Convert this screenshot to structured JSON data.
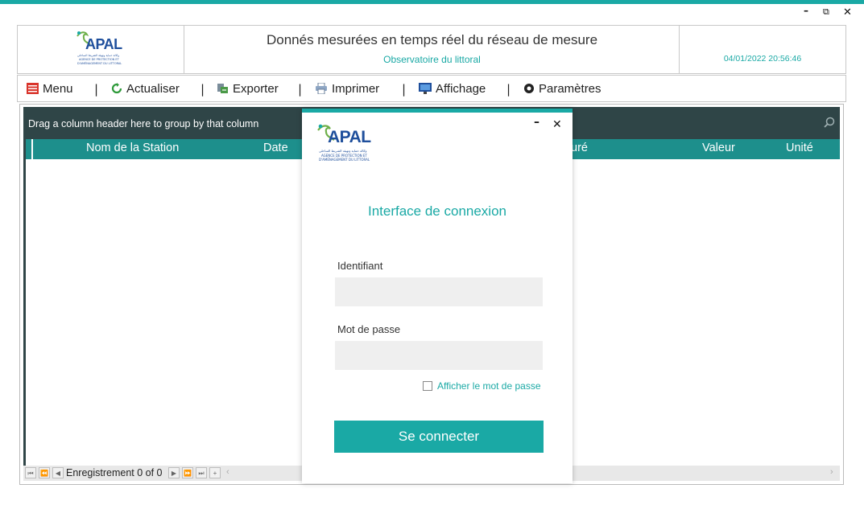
{
  "window": {
    "minimize": "–",
    "restore": "⧉",
    "close": "✕"
  },
  "header": {
    "title": "Donnés mesurées en temps réel du réseau de mesure",
    "subtitle": "Observatoire du littoral",
    "datetime": "04/01/2022 20:56:46",
    "logo": {
      "brand": "APAL",
      "line1": "وكالة حماية وتهيئة الشريط الساحلي",
      "line2": "AGENCE DE PROTECTION ET",
      "line3": "D'AMÉNAGEMENT DU LITTORAL"
    }
  },
  "toolbar": {
    "items": [
      {
        "label": "Menu",
        "icon": "menu-icon"
      },
      {
        "label": "Actualiser",
        "icon": "refresh-icon"
      },
      {
        "label": "Exporter",
        "icon": "export-icon"
      },
      {
        "label": "Imprimer",
        "icon": "printer-icon"
      },
      {
        "label": "Affichage",
        "icon": "monitor-icon"
      },
      {
        "label": "Paramètres",
        "icon": "gear-icon"
      }
    ],
    "separator": "|"
  },
  "grid": {
    "group_hint": "Drag a column header here to group by that column",
    "columns": [
      "Nom de la Station",
      "Date",
      "uré",
      "Valeur",
      "Unité"
    ],
    "pager_text": "Enregistrement 0 of 0"
  },
  "login": {
    "title": "Interface de connexion",
    "username_label": "Identifiant",
    "username_value": "",
    "password_label": "Mot de passe",
    "password_value": "",
    "show_password_label": "Afficher le mot de passe",
    "submit_label": "Se connecter",
    "minimize": "–",
    "close": "✕"
  },
  "colors": {
    "accent": "#1aa9a5",
    "dark": "#2f4547",
    "header_bg": "#1d8f8c",
    "brand": "#1f4f9c"
  }
}
